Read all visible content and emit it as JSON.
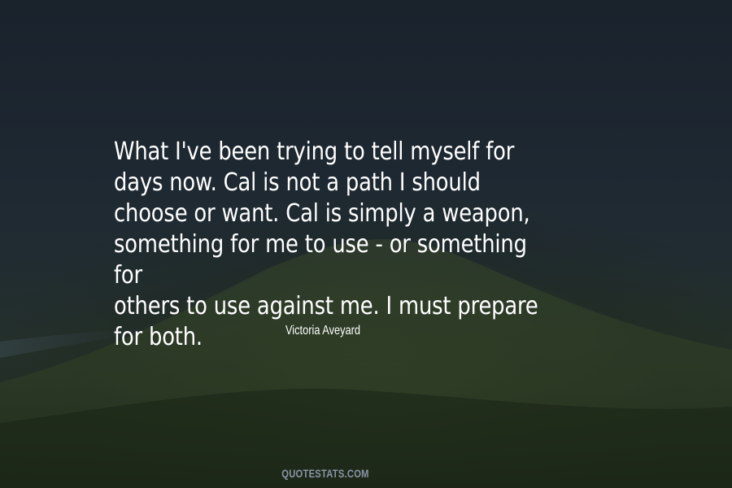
{
  "quote": {
    "text": "What I've been trying to tell myself for\ndays now. Cal is not a path I should\nchoose or want. Cal is simply a weapon,\nsomething for me to use - or something for\nothers to use against me. I must prepare\nfor both."
  },
  "author": {
    "name": "Victoria Aveyard"
  },
  "watermark": {
    "text": "QUOTESTATS.COM"
  },
  "colors": {
    "text": "#ffffff",
    "watermark": "#8b95a8",
    "background": "#1b232c",
    "foliage": "#3a4a2c"
  }
}
